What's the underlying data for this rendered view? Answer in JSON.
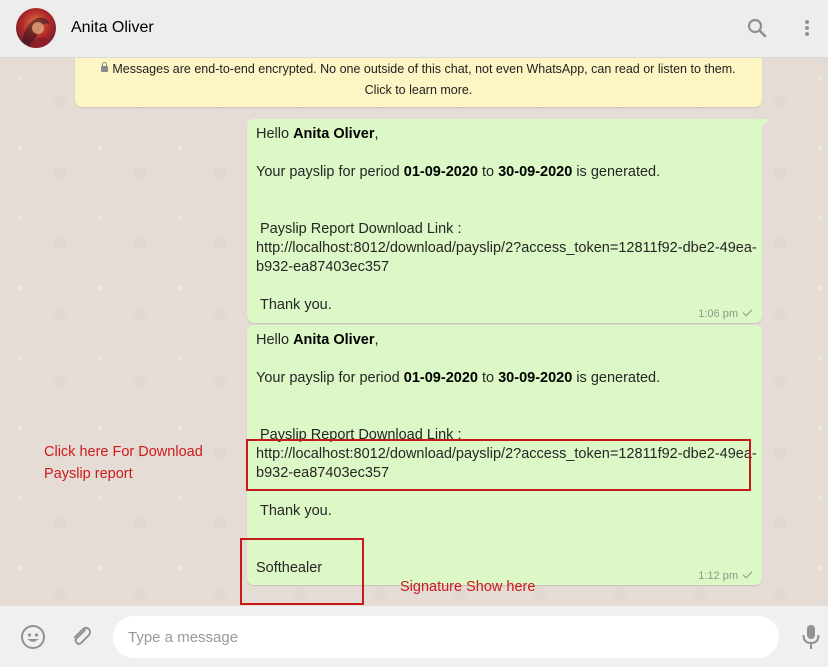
{
  "header": {
    "contact_name": "Anita Oliver"
  },
  "icons": {
    "search": "search-icon",
    "menu": "more-vertical-icon",
    "emoji": "emoji-icon",
    "attach": "paperclip-icon",
    "mic": "microphone-icon",
    "lock": "lock-icon",
    "read": "check-icon"
  },
  "notice": {
    "line1": "Messages are end-to-end encrypted. No one outside of this chat, not even WhatsApp, can read or listen to them.",
    "line2": "Click to learn more."
  },
  "messages": [
    {
      "greeting": "Hello",
      "name": "Anita Oliver",
      "comma": ",",
      "payslip_prefix": "Your payslip for period",
      "from": "01-09-2020",
      "to_word": "to",
      "to": "30-09-2020",
      "payslip_suffix": "is generated.",
      "link_label": "Payslip Report Download Link :",
      "link_line1": "http://localhost:8012/download/payslip/2?access_token=12811f92-dbe2-49ea-",
      "link_line2": "b932-ea87403ec357",
      "thanks": "Thank you.",
      "time": "1:06 pm"
    },
    {
      "greeting": "Hello",
      "name": "Anita Oliver",
      "comma": ",",
      "payslip_prefix": "Your payslip for period",
      "from": "01-09-2020",
      "to_word": "to",
      "to": "30-09-2020",
      "payslip_suffix": "is generated.",
      "link_label": "Payslip Report Download Link :",
      "link_line1": "http://localhost:8012/download/payslip/2?access_token=12811f92-dbe2-49ea-",
      "link_line2": "b932-ea87403ec357",
      "thanks": "Thank you.",
      "signature": "Softhealer",
      "time": "1:12 pm"
    }
  ],
  "annotations": {
    "download_line1": "Click here For Download",
    "download_line2": "Payslip report",
    "signature": "Signature Show here",
    "color": "#cc1b1b"
  },
  "composer": {
    "placeholder": "Type a message"
  },
  "colors": {
    "bubble": "#dcf8c6",
    "notice": "#fdf5c4",
    "header": "#ededed",
    "chat_bg": "#e5ddd5"
  }
}
